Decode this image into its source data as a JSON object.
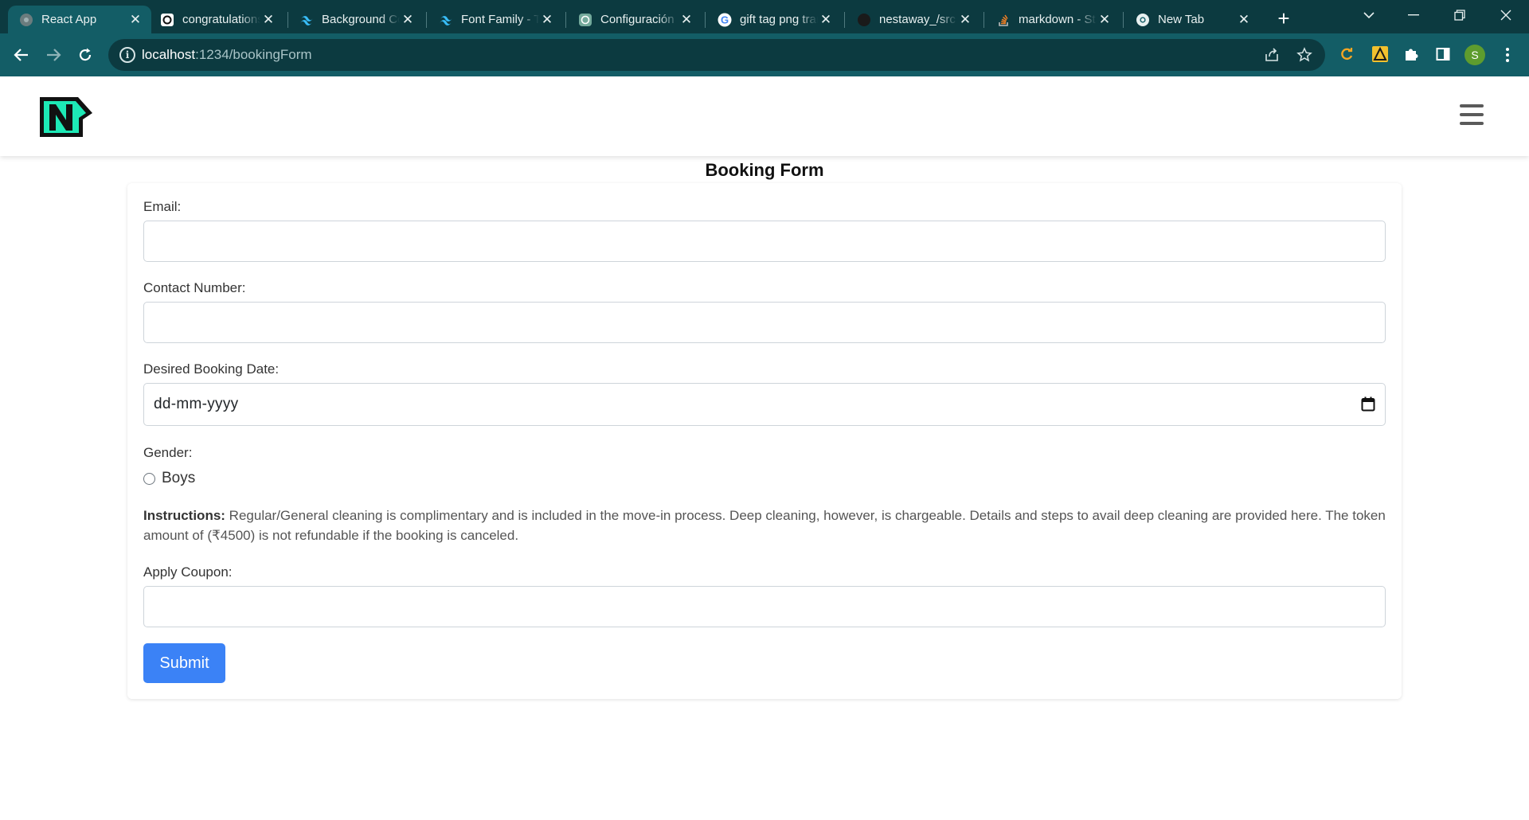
{
  "browser": {
    "tabs": [
      {
        "title": "React App",
        "icon": "react-app-favicon",
        "active": true
      },
      {
        "title": "congratulations",
        "icon": "openai-favicon",
        "active": false
      },
      {
        "title": "Background Color",
        "icon": "tailwind-favicon",
        "active": false
      },
      {
        "title": "Font Family - Tailwind",
        "icon": "tailwind-favicon",
        "active": false
      },
      {
        "title": "Configuración",
        "icon": "chatgpt-favicon",
        "active": false
      },
      {
        "title": "gift tag png transparent",
        "icon": "google-favicon",
        "active": false
      },
      {
        "title": "nestaway_/src",
        "icon": "github-favicon",
        "active": false
      },
      {
        "title": "markdown - Stack",
        "icon": "stackoverflow-favicon",
        "active": false
      },
      {
        "title": "New Tab",
        "icon": "chrome-favicon",
        "active": false
      }
    ],
    "url_host": "localhost",
    "url_path": ":1234/bookingForm",
    "profile_initial": "S",
    "colors": {
      "tabbar": "#0c3a40",
      "toolbar": "#135d66"
    }
  },
  "page": {
    "title": "Booking Form",
    "hamburger_icon": "hamburger-menu-icon",
    "form": {
      "email_label": "Email:",
      "email_value": "",
      "contact_label": "Contact Number:",
      "contact_value": "",
      "date_label": "Desired Booking Date:",
      "date_placeholder": "dd-mm-yyyy",
      "gender_label": "Gender:",
      "gender_option": "Boys",
      "instructions_label": "Instructions:",
      "instructions_text": " Regular/General cleaning is complimentary and is included in the move-in process. Deep cleaning, however, is chargeable. Details and steps to avail deep cleaning are provided here. The token amount of (₹4500) is not refundable if the booking is canceled.",
      "coupon_label": "Apply Coupon:",
      "coupon_value": "",
      "submit_label": "Submit"
    },
    "colors": {
      "submit": "#3b82f6",
      "logo_accent": "#1de9b6"
    }
  }
}
